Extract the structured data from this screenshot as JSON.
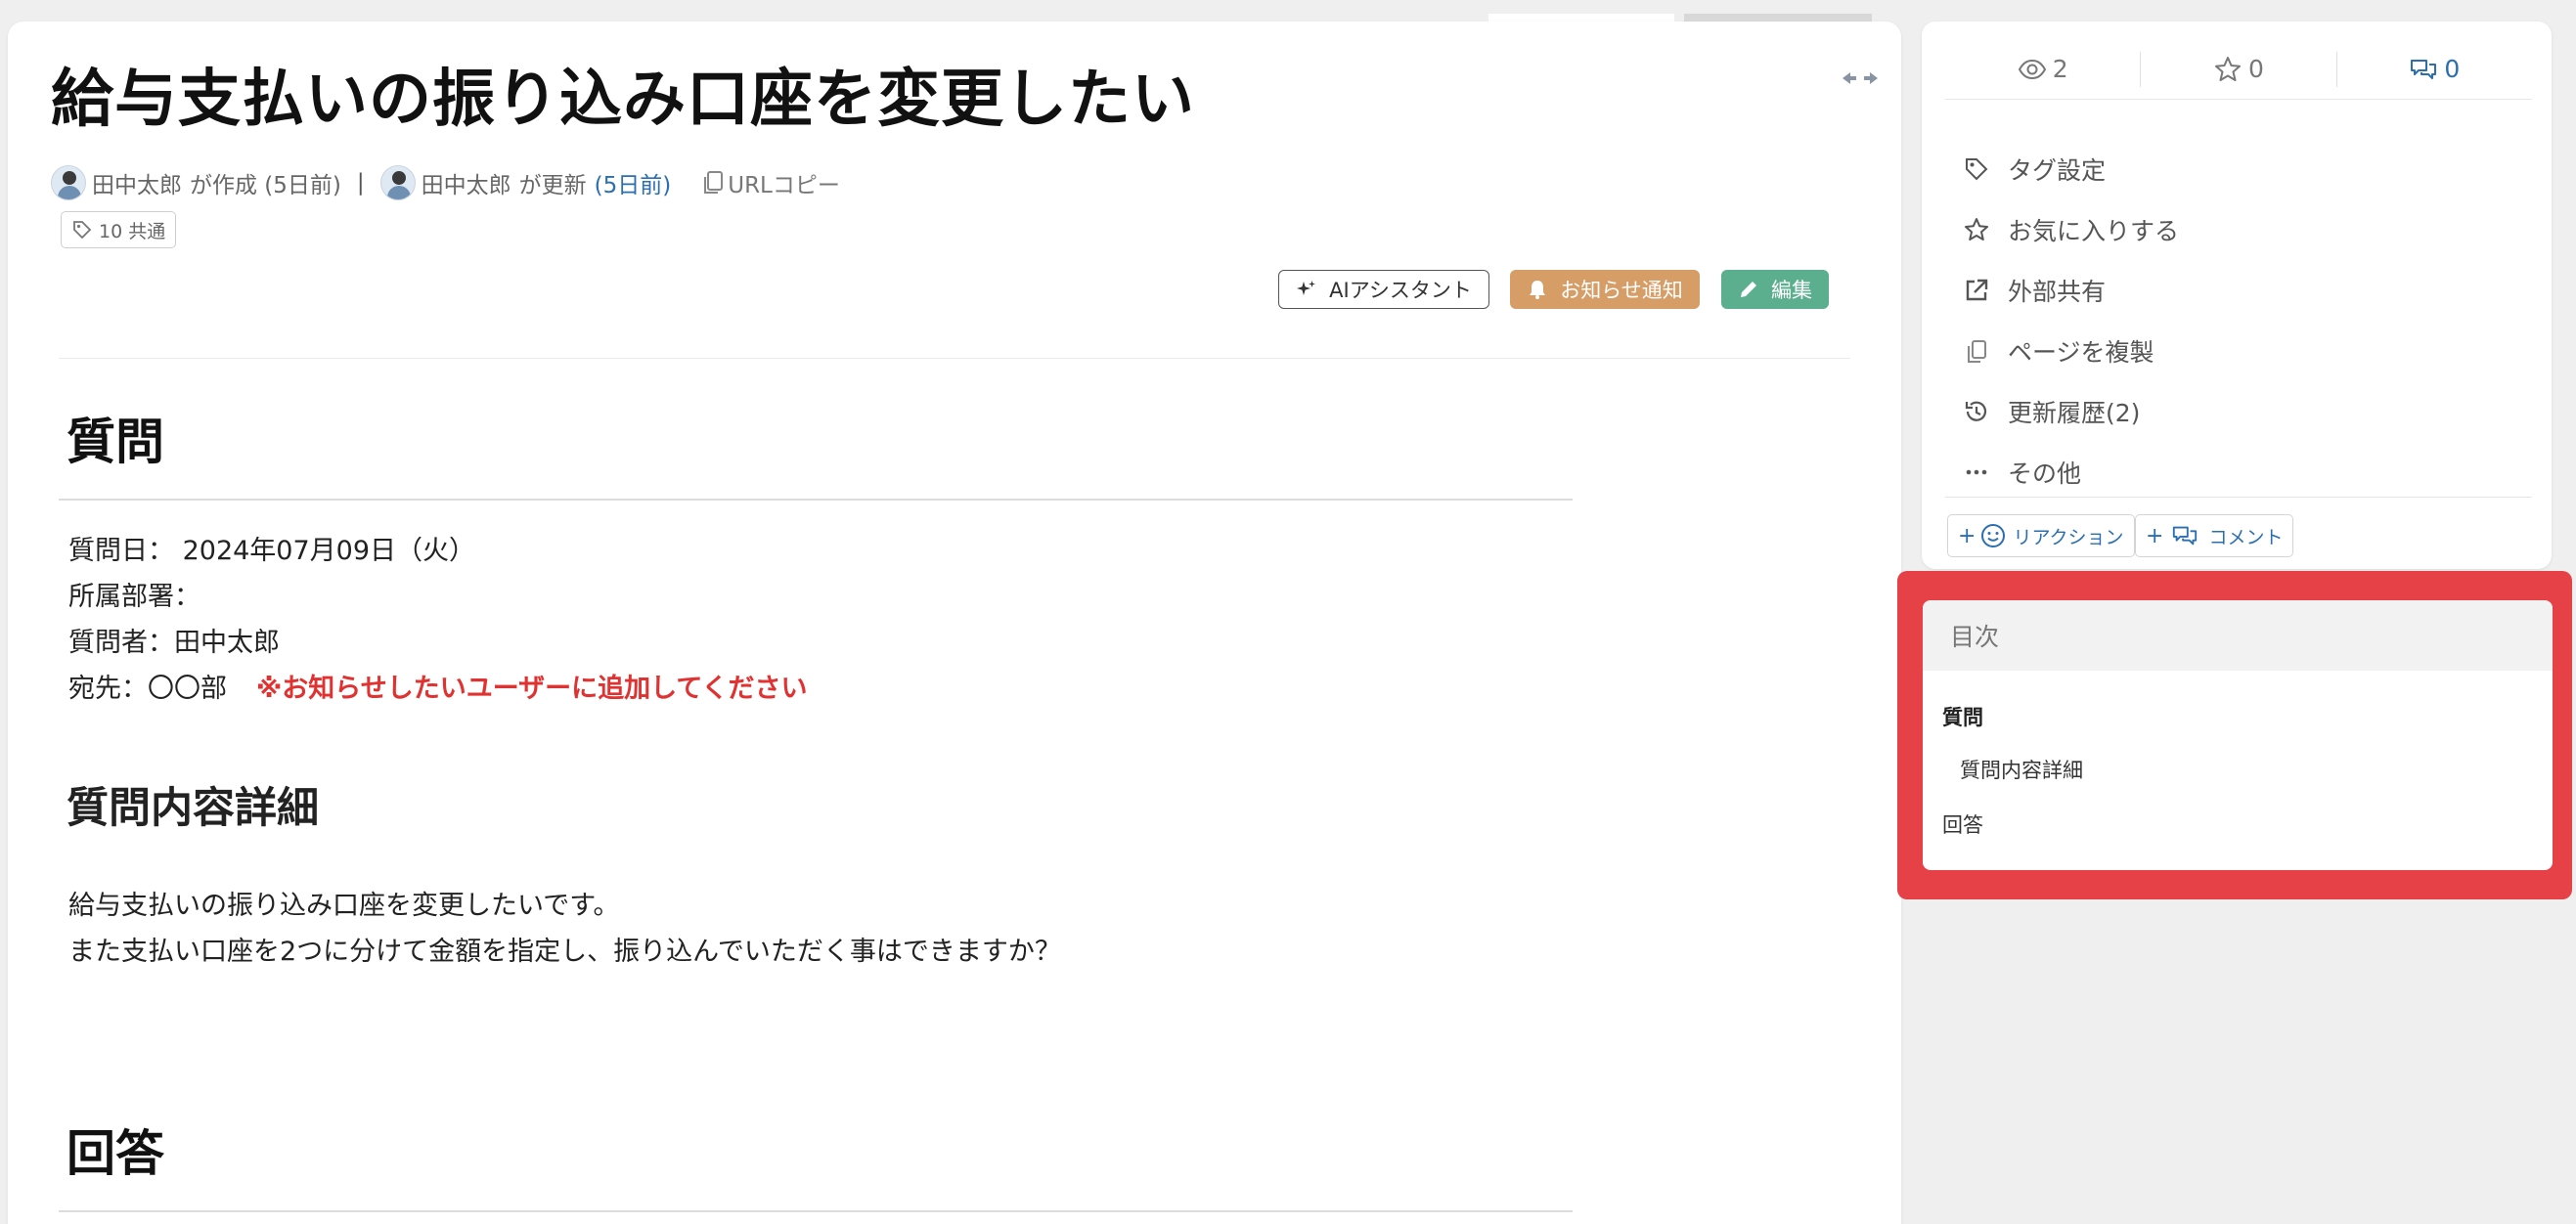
{
  "page": {
    "title": "給与支払いの振り込み口座を変更したい",
    "meta": {
      "creator": "田中太郎",
      "created_text": "が作成 (5日前)",
      "separator": "|",
      "updater": "田中太郎",
      "updated_text": "が更新",
      "updated_time": "(5日前)",
      "copy_url": "URLコピー"
    },
    "tag": "10 共通",
    "buttons": {
      "ai": "AIアシスタント",
      "notify": "お知らせ通知",
      "edit": "編集"
    }
  },
  "content": {
    "section_question": "質問",
    "lines": [
      "質問日： 2024年07月09日（火）",
      "所属部署：",
      "質問者：田中太郎",
      "宛先：〇〇部"
    ],
    "warning": "※お知らせしたいユーザーに追加してください",
    "section_detail": "質問内容詳細",
    "detail_lines": [
      "給与支払いの振り込み口座を変更したいです。",
      "また支払い口座を2つに分けて金額を指定し、振り込んでいただく事はできますか？"
    ],
    "section_answer": "回答"
  },
  "sidebar": {
    "stats": {
      "views": "2",
      "stars": "0",
      "comments": "0"
    },
    "menu": [
      {
        "icon": "tag-icon",
        "label": "タグ設定"
      },
      {
        "icon": "star-icon",
        "label": "お気に入りする"
      },
      {
        "icon": "external-link-icon",
        "label": "外部共有"
      },
      {
        "icon": "copy-icon",
        "label": "ページを複製"
      },
      {
        "icon": "history-icon",
        "label": "更新履歴(2)"
      },
      {
        "icon": "more-icon",
        "label": "その他"
      }
    ],
    "reaction_label": "リアクション",
    "comment_label": "コメント"
  },
  "toc": {
    "title": "目次",
    "items": [
      "質問",
      "質問内容詳細",
      "回答"
    ]
  },
  "colors": {
    "accent_blue": "#2c6fb0",
    "notify_orange": "#d69d66",
    "edit_green": "#5bae8e",
    "warning_red": "#e13232",
    "highlight_red": "#e54147"
  }
}
